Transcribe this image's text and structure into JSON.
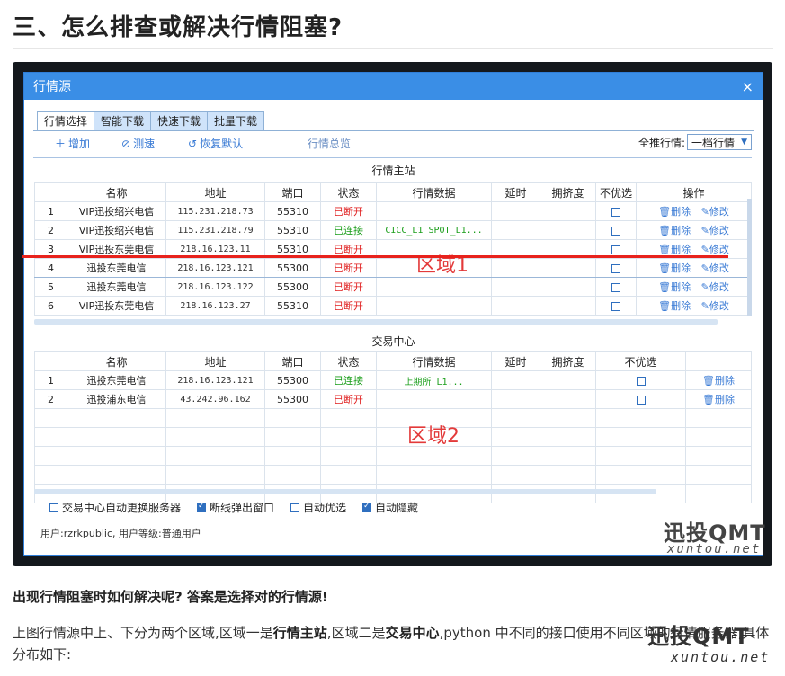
{
  "heading": "三、怎么排查或解决行情阻塞?",
  "dialog": {
    "title": "行情源",
    "close": "×",
    "tabs": [
      "行情选择",
      "智能下载",
      "快速下载",
      "批量下载"
    ],
    "toolbar": {
      "add": "增加",
      "speed_test": "测速",
      "restore": "恢复默认",
      "summary": "行情总览",
      "rank_label": "全推行情:",
      "rank_value": "一档行情"
    },
    "main_station": {
      "title": "行情主站",
      "columns": [
        "",
        "名称",
        "地址",
        "端口",
        "状态",
        "行情数据",
        "延时",
        "拥挤度",
        "不优选",
        "操作"
      ],
      "rows": [
        {
          "idx": "1",
          "name": "VIP迅投绍兴电信",
          "addr": "115.231.218.73",
          "port": "55310",
          "status": "已断开",
          "data": "",
          "delay": "",
          "crowd": "",
          "exclude": false
        },
        {
          "idx": "2",
          "name": "VIP迅投绍兴电信",
          "addr": "115.231.218.79",
          "port": "55310",
          "status": "已连接",
          "data": "CICC_L1 SPOT_L1...",
          "delay": "",
          "crowd": "",
          "exclude": false
        },
        {
          "idx": "3",
          "name": "VIP迅投东莞电信",
          "addr": "218.16.123.11",
          "port": "55310",
          "status": "已断开",
          "data": "",
          "delay": "",
          "crowd": "",
          "exclude": false
        },
        {
          "idx": "4",
          "name": "迅投东莞电信",
          "addr": "218.16.123.121",
          "port": "55300",
          "status": "已断开",
          "data": "",
          "delay": "",
          "crowd": "",
          "exclude": false
        },
        {
          "idx": "5",
          "name": "迅投东莞电信",
          "addr": "218.16.123.122",
          "port": "55300",
          "status": "已断开",
          "data": "",
          "delay": "",
          "crowd": "",
          "exclude": false
        },
        {
          "idx": "6",
          "name": "VIP迅投东莞电信",
          "addr": "218.16.123.27",
          "port": "55310",
          "status": "已断开",
          "data": "",
          "delay": "",
          "crowd": "",
          "exclude": false
        }
      ],
      "delete_label": "删除",
      "edit_label": "修改"
    },
    "exchange_center": {
      "title": "交易中心",
      "columns": [
        "",
        "名称",
        "地址",
        "端口",
        "状态",
        "行情数据",
        "延时",
        "拥挤度",
        "不优选",
        ""
      ],
      "rows": [
        {
          "idx": "1",
          "name": "迅投东莞电信",
          "addr": "218.16.123.121",
          "port": "55300",
          "status": "已连接",
          "data": "上期所_L1...",
          "exclude": false
        },
        {
          "idx": "2",
          "name": "迅投浦东电信",
          "addr": "43.242.96.162",
          "port": "55300",
          "status": "已断开",
          "data": "",
          "exclude": false
        }
      ],
      "delete_label": "删除"
    },
    "zone1_label": "区域1",
    "zone2_label": "区域2",
    "options": [
      {
        "label": "交易中心自动更换服务器",
        "checked": false
      },
      {
        "label": "断线弹出窗口",
        "checked": true
      },
      {
        "label": "自动优选",
        "checked": false
      },
      {
        "label": "自动隐藏",
        "checked": true
      }
    ],
    "status_line": "用户:rzrkpublic, 用户等级:普通用户"
  },
  "watermark": {
    "big": "迅投QMT",
    "small": "xuntou.net"
  },
  "para1": "出现行情阻塞时如何解决呢? 答案是选择对的行情源!",
  "para2": {
    "p1": "上图行情源中上、下分为两个区域,区域一是",
    "b1": "行情主站",
    "p2": ",区域二是",
    "b2": "交易中心",
    "p3": ",python 中不同的接口使用不同区域的行情服务器,具体分布如下:"
  },
  "colors": {
    "titlebar": "#3a8ee6",
    "connected": "#1a9e1a",
    "disconnected": "#e02020",
    "link": "#3a7bd5",
    "annotation": "#e8221c"
  }
}
